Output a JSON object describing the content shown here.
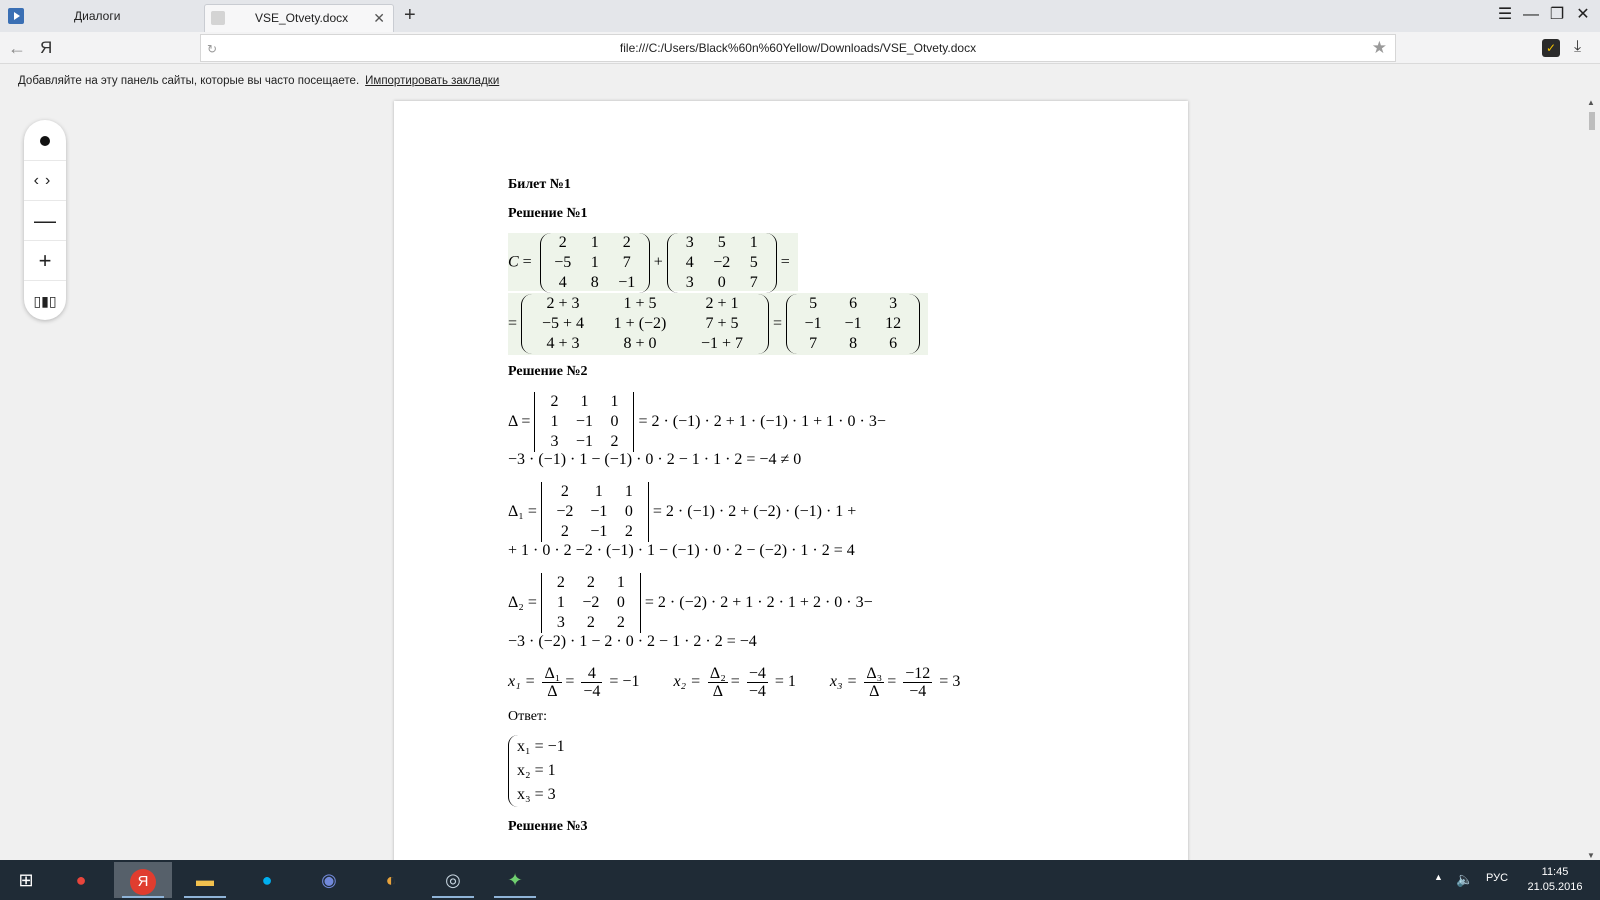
{
  "browser": {
    "tabs": [
      {
        "label": "Диалоги"
      },
      {
        "label": "VSE_Otvety.docx"
      }
    ],
    "new_tab_symbol": "+",
    "url": "file:///C:/Users/Black%60n%60Yellow/Downloads/VSE_Otvety.docx",
    "logo_text": "Я",
    "bookmarks_hint": "Добавляйте на эту панель сайты, которые вы часто посещаете.",
    "bookmarks_link": "Импортировать закладки"
  },
  "document": {
    "ticket": "Билет №1",
    "solution1": {
      "heading": "Решение №1",
      "matrix_A": [
        [
          "2",
          "1",
          "2"
        ],
        [
          "−5",
          "1",
          "7"
        ],
        [
          "4",
          "8",
          "−1"
        ]
      ],
      "matrix_B": [
        [
          "3",
          "5",
          "1"
        ],
        [
          "4",
          "−2",
          "5"
        ],
        [
          "3",
          "0",
          "7"
        ]
      ],
      "sum_expr": [
        [
          "2 + 3",
          "1 + 5",
          "2 + 1"
        ],
        [
          "−5 + 4",
          "1 + (−2)",
          "7 + 5"
        ],
        [
          "4 + 3",
          "8 + 0",
          "−1 + 7"
        ]
      ],
      "result": [
        [
          "5",
          "6",
          "3"
        ],
        [
          "−1",
          "−1",
          "12"
        ],
        [
          "7",
          "8",
          "6"
        ]
      ]
    },
    "solution2": {
      "heading": "Решение №2",
      "delta_label": "Δ =",
      "delta_matrix": [
        [
          "2",
          "1",
          "1"
        ],
        [
          "1",
          "−1",
          "0"
        ],
        [
          "3",
          "−1",
          "2"
        ]
      ],
      "delta_line1": "= 2 · (−1) · 2 + 1 · (−1) · 1 + 1 · 0 · 3−",
      "delta_line2": "−3 · (−1) · 1 − (−1) · 0 · 2 − 1 · 1 · 2 = −4 ≠ 0",
      "delta1_label": "Δ₁ =",
      "delta1_matrix": [
        [
          "2",
          "1",
          "1"
        ],
        [
          "−2",
          "−1",
          "0"
        ],
        [
          "2",
          "−1",
          "2"
        ]
      ],
      "delta1_line1": "= 2 · (−1) · 2 + (−2) · (−1) · 1 +",
      "delta1_line2": "+ 1 · 0 · 2 −2 · (−1) · 1 − (−1) · 0 · 2 − (−2) · 1 · 2 = 4",
      "delta2_label": "Δ₂ =",
      "delta2_matrix": [
        [
          "2",
          "2",
          "1"
        ],
        [
          "1",
          "−2",
          "0"
        ],
        [
          "3",
          "2",
          "2"
        ]
      ],
      "delta2_line1": "= 2 · (−2) · 2 + 1 · 2 · 1 + 2 · 0 · 3−",
      "delta2_line2": "−3 · (−2) · 1 − 2 · 0 · 2 − 1 · 2 · 2 = −4",
      "x1": {
        "lhs": "x₁ =",
        "f1_num": "Δ₁",
        "f1_den": "Δ",
        "f2_num": "4",
        "f2_den": "−4",
        "result": "= −1"
      },
      "x2": {
        "lhs": "x₂ =",
        "f1_num": "Δ₂",
        "f1_den": "Δ",
        "f2_num": "−4",
        "f2_den": "−4",
        "result": "= 1"
      },
      "x3": {
        "lhs": "x₃ =",
        "f1_num": "Δ₃",
        "f1_den": "Δ",
        "f2_num": "−12",
        "f2_den": "−4",
        "result": "= 3"
      },
      "answer_label": "Ответ:",
      "answer_lines": [
        "x₁ = −1",
        "x₂ = 1",
        "x₃ = 3"
      ]
    },
    "solution3": {
      "heading": "Решение №3"
    }
  },
  "taskbar": {
    "language": "РУС",
    "time": "11:45",
    "date": "21.05.2016"
  }
}
